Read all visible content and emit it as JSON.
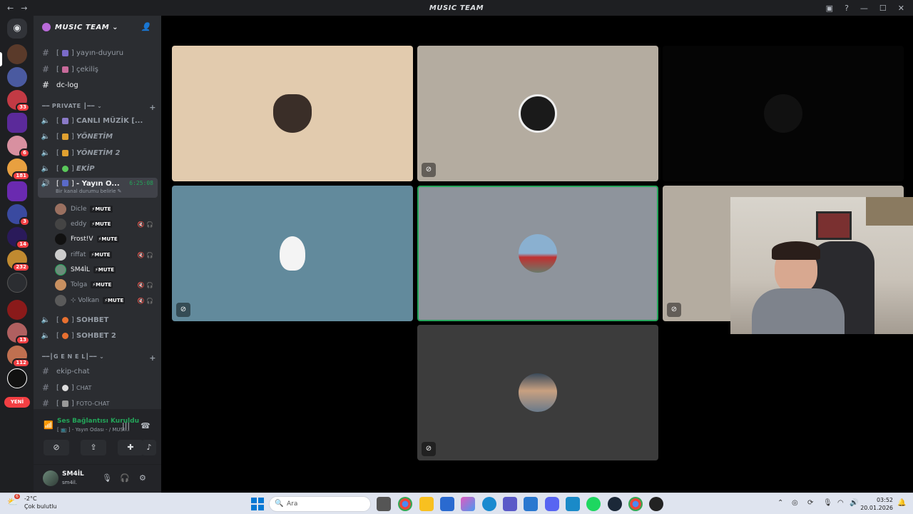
{
  "window": {
    "title": "MUSIC TEAM"
  },
  "servers": {
    "badges": [
      "33",
      "6",
      "181",
      "3",
      "14",
      "232",
      "13",
      "112"
    ],
    "new_label": "YENİ"
  },
  "server": {
    "name": "MUSIC TEAM"
  },
  "channels": {
    "top": [
      {
        "name": "yayın-duyuru",
        "emoji": "📢"
      },
      {
        "name": "çekiliş",
        "emoji": "🎉"
      },
      {
        "name": "dc-log",
        "emoji": ""
      }
    ],
    "private_category": "━━ PRIVATE ┃━━",
    "private": [
      {
        "name": "CANLI MÜZİK  [...",
        "emoji": "🎶"
      },
      {
        "name": "YÖNETİM",
        "emoji": "👑"
      },
      {
        "name": "YÖNETİM 2",
        "emoji": "👑"
      },
      {
        "name": "EKİP",
        "emoji": "👽"
      }
    ],
    "active": {
      "name": "- Yayın O...",
      "time": "6:25:08",
      "status": "Bir kanal durumu belirle"
    },
    "voice_users": [
      {
        "name": "Dicle",
        "mute": "⚡MUTE",
        "icons": ""
      },
      {
        "name": "eddy",
        "mute": "⚡MUTE",
        "icons": "🔇 🎧"
      },
      {
        "name": "Frost!V",
        "mute": "⚡MUTE",
        "icons": ""
      },
      {
        "name": "riffat",
        "mute": "⚡MUTE",
        "icons": "🔇 🎧"
      },
      {
        "name": "SM4İL",
        "mute": "⚡MUTE",
        "icons": ""
      },
      {
        "name": "Tolga",
        "mute": "⚡MUTE",
        "icons": "🔇 🎧"
      },
      {
        "name": "⊹ Volkan",
        "mute": "⚡MUTE",
        "icons": "🔇 🎧"
      }
    ],
    "sohbet": [
      {
        "name": "SOHBET",
        "emoji": "🔥"
      },
      {
        "name": "SOHBET 2",
        "emoji": "🔥"
      }
    ],
    "genel_category": "━━┃G E N E L┃━━",
    "genel": [
      {
        "name": "ekip-chat",
        "emoji": ""
      },
      {
        "name": "CHAT",
        "emoji": "💬"
      },
      {
        "name": "FOTO-CHAT",
        "emoji": "📷"
      }
    ]
  },
  "voice_panel": {
    "status": "Ses Bağlantısı Kuruldu",
    "channel": "[ 📺 ] - Yayın Odası - / MUSI..."
  },
  "user": {
    "name": "SM4İL",
    "tag": "sm4il."
  },
  "taskbar": {
    "weather_temp": "-2°C",
    "weather_cond": "Çok bulutlu",
    "weather_badge": "6",
    "search_placeholder": "Ara",
    "time": "03:52",
    "date": "20.01.2026"
  },
  "colors": {
    "accent": "#23a559",
    "danger": "#f23f43",
    "sidebar": "#2b2d31",
    "rail": "#1e1f22"
  }
}
